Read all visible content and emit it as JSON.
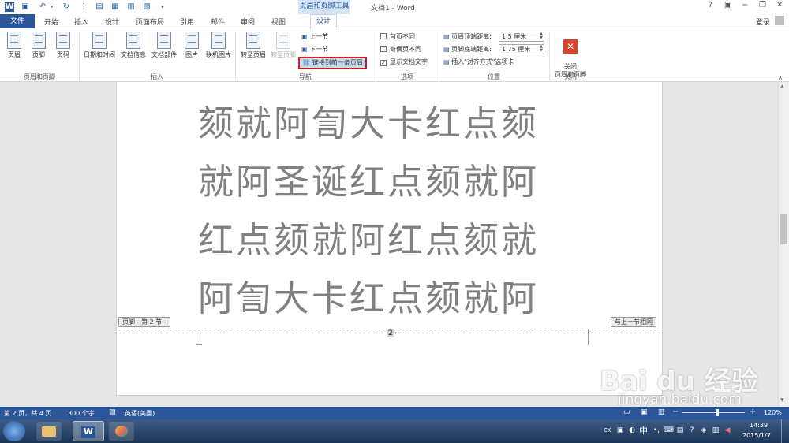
{
  "window": {
    "title": "文档1 - Word",
    "context_tab_group": "页眉和页脚工具",
    "help": "?",
    "login": "登录"
  },
  "tabs": [
    "文件",
    "开始",
    "插入",
    "设计",
    "页面布局",
    "引用",
    "邮件",
    "审阅",
    "视图",
    "设计"
  ],
  "ribbon": {
    "group_header_footer": {
      "label": "页眉和页脚",
      "buttons": [
        "页眉",
        "页脚",
        "页码"
      ]
    },
    "group_insert": {
      "label": "插入",
      "buttons": [
        "日期和时间",
        "文档信息",
        "文档部件",
        "图片",
        "联机图片"
      ]
    },
    "group_navigation": {
      "label": "导航",
      "goto_header": "转至页眉",
      "goto_footer": "转至页脚",
      "prev_section": "上一节",
      "next_section": "下一节",
      "link_to_previous": "链接到前一条页眉"
    },
    "group_options": {
      "label": "选项",
      "different_first_page": "首页不同",
      "different_odd_even": "奇偶页不同",
      "show_document_text": "显示文档文字"
    },
    "group_position": {
      "label": "位置",
      "header_from_top_label": "页眉顶端距离:",
      "header_from_top_value": "1.5 厘米",
      "footer_from_bottom_label": "页脚底端距离:",
      "footer_from_bottom_value": "1.75 厘米",
      "insert_alignment_tab": "插入\"对齐方式\"选项卡"
    },
    "group_close": {
      "label": "关闭",
      "button": "关闭\n页眉和页脚"
    }
  },
  "document": {
    "lines": [
      "颏就阿訇大卡红点颏",
      "就阿圣诞红点颏就阿",
      "红点颏就阿红点颏就",
      "阿訇大卡红点颏就阿"
    ],
    "footer_tag": "页脚 - 第 2 节 -",
    "same_as_previous_tag": "与上一节相同",
    "page_number": "2"
  },
  "statusbar": {
    "page_info": "第 2 页，共 4 页",
    "word_count": "300 个字",
    "language": "英语(美国)",
    "zoom": "120%"
  },
  "taskbar": {
    "time": "14:39",
    "date": "2015/1/7",
    "ime": "中"
  },
  "watermark": {
    "brand": "Bai du 经验",
    "url": "jingyan.baidu.com"
  },
  "colors": {
    "accent": "#2b579a",
    "highlight_border": "#d11c1c"
  }
}
